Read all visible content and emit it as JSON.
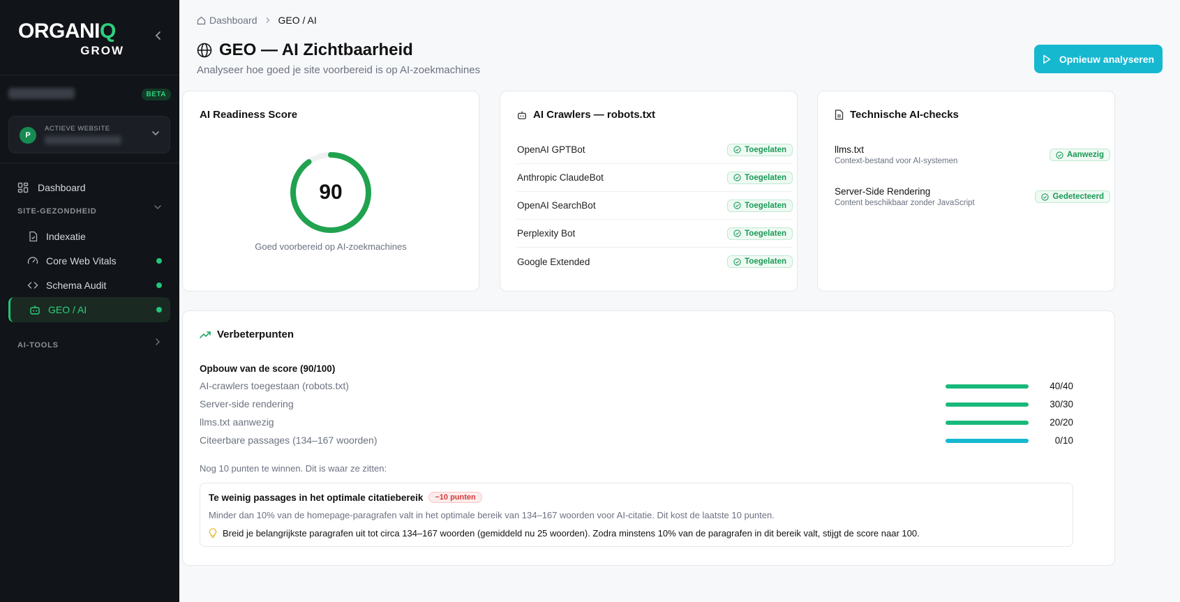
{
  "sidebar": {
    "logo_text": "ORGANIQ",
    "logo_sub": "GROW",
    "beta": "BETA",
    "site_label": "ACTIEVE WEBSITE",
    "site_initial": "P",
    "nav": {
      "dashboard": "Dashboard",
      "section_health": "SITE-GEZONDHEID",
      "indexatie": "Indexatie",
      "cwv": "Core Web Vitals",
      "schema": "Schema Audit",
      "geo": "GEO / AI",
      "section_tools": "AI-TOOLS"
    }
  },
  "breadcrumb": {
    "home": "Dashboard",
    "current": "GEO / AI"
  },
  "header": {
    "title": "GEO — AI Zichtbaarheid",
    "subtitle": "Analyseer hoe goed je site voorbereid is op AI-zoekmachines",
    "button": "Opnieuw analyseren"
  },
  "score_card": {
    "title": "AI Readiness Score",
    "score": "90",
    "score_value": 90,
    "score_max": 100,
    "caption": "Goed voorbereid op AI-zoekmachines"
  },
  "crawlers_card": {
    "title": "AI Crawlers — robots.txt",
    "rows": [
      {
        "name": "OpenAI GPTBot",
        "status": "Toegelaten"
      },
      {
        "name": "Anthropic ClaudeBot",
        "status": "Toegelaten"
      },
      {
        "name": "OpenAI SearchBot",
        "status": "Toegelaten"
      },
      {
        "name": "Perplexity Bot",
        "status": "Toegelaten"
      },
      {
        "name": "Google Extended",
        "status": "Toegelaten"
      }
    ]
  },
  "checks_card": {
    "title": "Technische AI-checks",
    "rows": [
      {
        "title": "llms.txt",
        "desc": "Context-bestand voor AI-systemen",
        "status": "Aanwezig"
      },
      {
        "title": "Server-Side Rendering",
        "desc": "Content beschikbaar zonder JavaScript",
        "status": "Gedetecteerd"
      }
    ]
  },
  "improvements": {
    "title": "Verbeterpunten",
    "breakdown_title": "Opbouw van de score (90/100)",
    "rows": [
      {
        "label": "AI-crawlers toegestaan (robots.txt)",
        "value": "40/40",
        "fraction": 1.0
      },
      {
        "label": "Server-side rendering",
        "value": "30/30",
        "fraction": 1.0
      },
      {
        "label": "llms.txt aanwezig",
        "value": "20/20",
        "fraction": 1.0
      },
      {
        "label": "Citeerbare passages (134–167 woorden)",
        "value": "0/10",
        "fraction": 1.0
      }
    ],
    "remaining": "Nog 10 punten te winnen. Dit is waar ze zitten:",
    "issue": {
      "title": "Te weinig passages in het optimale citatiebereik",
      "penalty": "−10 punten",
      "desc": "Minder dan 10% van de homepage-paragrafen valt in het optimale bereik van 134–167 woorden voor AI-citatie. Dit kost de laatste 10 punten.",
      "tip": "Breid je belangrijkste paragrafen uit tot circa 134–167 woorden (gemiddeld nu 25 woorden). Zodra minstens 10% van de paragrafen in dit bereik valt, stijgt de score naar 100."
    }
  },
  "colors": {
    "accent": "#16b8d0",
    "green": "#22c57a",
    "sidebar": "#111418"
  }
}
